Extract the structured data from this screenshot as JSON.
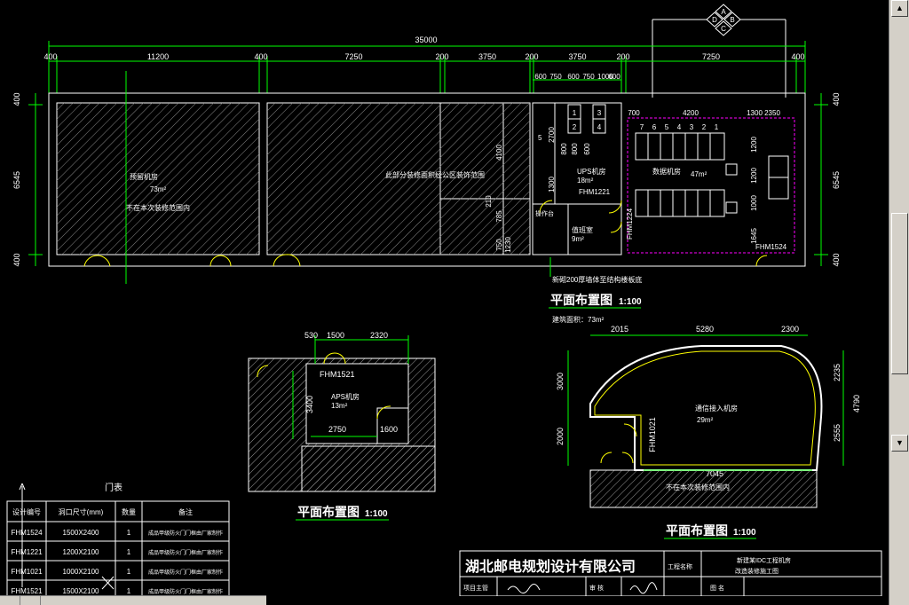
{
  "compass": {
    "a": "A",
    "b": "B",
    "c": "C",
    "d": "D"
  },
  "plan_main": {
    "overall_dim": "35000",
    "dim_row": [
      "400",
      "11200",
      "400",
      "7250",
      "200",
      "3750",
      "200",
      "3750",
      "200",
      "7250",
      "400"
    ],
    "sub_dims": [
      "600",
      "750",
      "600",
      "750",
      "1000",
      "600"
    ],
    "left_dims": [
      "400",
      "6545",
      "400"
    ],
    "right_dims": [
      "400",
      "6545",
      "400"
    ],
    "room1_name": "预留机房",
    "room1_area": "73m²",
    "room1_note": "不在本次装修范围内",
    "room2_note": "此部分装修面积经公区装饰范围",
    "ups_room": "UPS机房",
    "ups_area": "18m²",
    "door_label_1": "FHM1221",
    "door_label_2": "FHM1224",
    "door_label_3": "FHM1524",
    "hall_label": "操作台",
    "duty_room": "值班室",
    "duty_area": "9m²",
    "equip_room": "数据机房",
    "equip_area": "47m²",
    "mid_dims": [
      "4100",
      "2700",
      "1300",
      "210",
      "785",
      "750",
      "1230"
    ],
    "rack_nums": [
      "7",
      "6",
      "5",
      "4",
      "3",
      "2",
      "1"
    ],
    "right_inner_dims": [
      "700",
      "4200",
      "1300",
      "2350",
      "1200",
      "1200",
      "1000",
      "1645"
    ],
    "stack_dims": [
      "800",
      "800",
      "600"
    ],
    "num_1": "1",
    "num_2": "2",
    "num_3": "3",
    "num_4": "4",
    "five_label": "5",
    "wall_note": "新砌200厚墙体至结构楼板底",
    "title": "平面布置图",
    "scale": "1:100",
    "area_note": "建筑面积：73m²"
  },
  "plan_small": {
    "top_dims": [
      "530",
      "1500",
      "2320"
    ],
    "door": "FHM1521",
    "room_name": "APS机房",
    "room_area": "13m²",
    "dim_h": "3400",
    "dim_w": "2750",
    "dim_w2": "1600",
    "title": "平面布置图",
    "scale": "1:100"
  },
  "plan_right": {
    "top_dims": [
      "2015",
      "5280",
      "2300"
    ],
    "left_dims": [
      "3000",
      "2000"
    ],
    "right_dims": [
      "2235",
      "4790",
      "2555"
    ],
    "door": "FHM1021",
    "room_name": "通信接入机房",
    "room_area": "29m²",
    "bottom_dim": "7045",
    "note": "不在本次装修范围内",
    "title": "平面布置图",
    "scale": "1:100"
  },
  "door_table": {
    "caption": "门表",
    "headers": [
      "设计编号",
      "洞口尺寸(mm)",
      "数量",
      "备注"
    ],
    "rows": [
      [
        "FHM1524",
        "1500X2400",
        "1",
        "成品甲级防火门门框由厂家制作"
      ],
      [
        "FHM1221",
        "1200X2100",
        "1",
        "成品甲级防火门门框由厂家制作"
      ],
      [
        "FHM1021",
        "1000X2100",
        "1",
        "成品甲级防火门门框由厂家制作"
      ],
      [
        "FHM1521",
        "1500X2100",
        "1",
        "成品甲级防火门门框由厂家制作"
      ]
    ]
  },
  "title_block": {
    "company": "湖北邮电规划设计有限公司",
    "project_label": "工程名称",
    "project_name_1": "新建某IDC工程机房",
    "project_name_2": "改造装修施工图",
    "row2_a": "项目主管",
    "row2_b": "审 核",
    "row2_c": "图 名"
  },
  "colors": {
    "wall": "#ffffff",
    "dim": "#00ff00",
    "text": "#ffffff",
    "door": "#ffff00",
    "magenta": "#ff00ff",
    "cyan": "#00ffff",
    "hatch": "#9a9a9a"
  }
}
